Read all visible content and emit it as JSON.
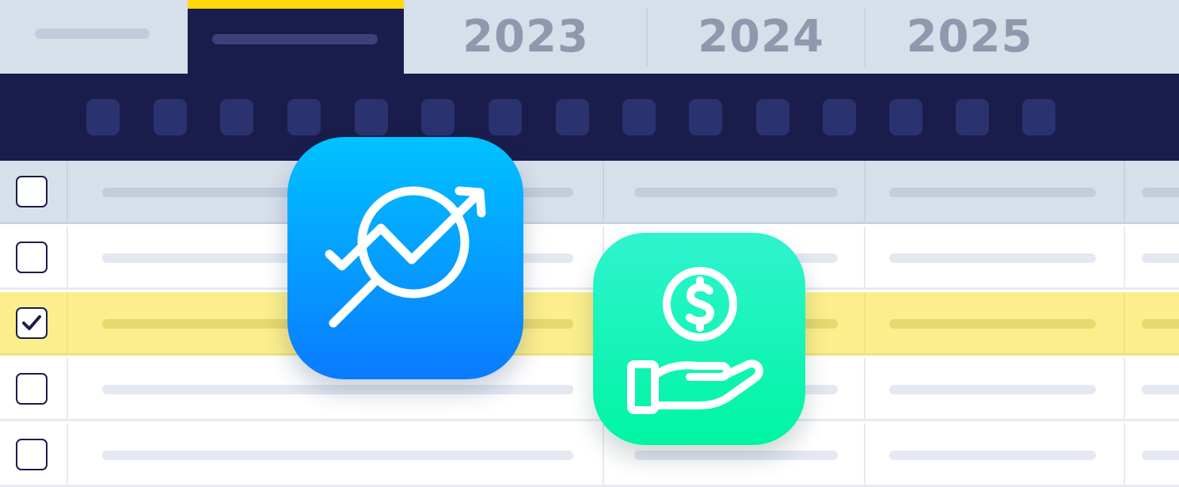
{
  "tabs": [
    {
      "label": "",
      "state": "placeholder"
    },
    {
      "label": "",
      "state": "active"
    },
    {
      "label": "2023"
    },
    {
      "label": "2024"
    },
    {
      "label": "2025"
    }
  ],
  "toolbar": {
    "button_count": 15
  },
  "table": {
    "rows": [
      {
        "type": "header",
        "checked": false
      },
      {
        "type": "row",
        "checked": false
      },
      {
        "type": "row",
        "checked": true
      },
      {
        "type": "row",
        "checked": false
      },
      {
        "type": "row",
        "checked": false
      }
    ]
  },
  "apps": [
    {
      "icon": "analytics-magnifier-trend-icon"
    },
    {
      "icon": "hand-holding-dollar-icon"
    }
  ],
  "colors": {
    "navy": "#1a1d4b",
    "accent_yellow": "#ffd90a",
    "selected_row": "#fcee8c",
    "analytics_gradient": [
      "#00c2ff",
      "#0a7bff"
    ],
    "payment_gradient": [
      "#2ff3cf",
      "#00f5a2"
    ]
  }
}
